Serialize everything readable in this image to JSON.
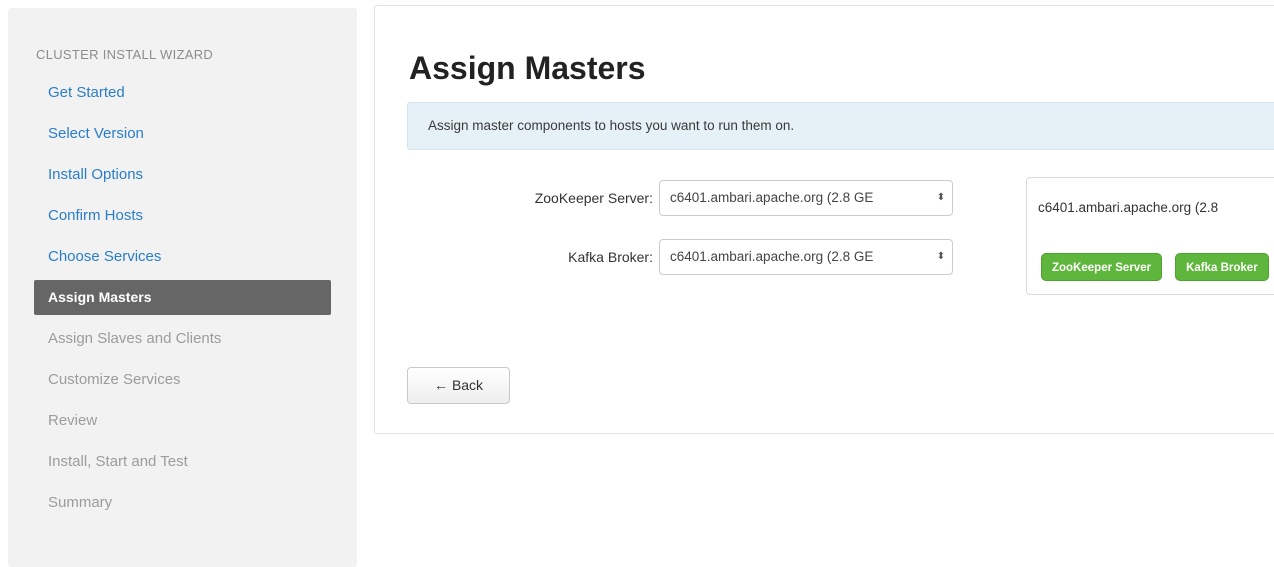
{
  "sidebar": {
    "heading": "CLUSTER INSTALL WIZARD",
    "steps": [
      {
        "label": "Get Started",
        "state": "done"
      },
      {
        "label": "Select Version",
        "state": "done"
      },
      {
        "label": "Install Options",
        "state": "done"
      },
      {
        "label": "Confirm Hosts",
        "state": "done"
      },
      {
        "label": "Choose Services",
        "state": "done"
      },
      {
        "label": "Assign Masters",
        "state": "active"
      },
      {
        "label": "Assign Slaves and Clients",
        "state": "pending"
      },
      {
        "label": "Customize Services",
        "state": "pending"
      },
      {
        "label": "Review",
        "state": "pending"
      },
      {
        "label": "Install, Start and Test",
        "state": "pending"
      },
      {
        "label": "Summary",
        "state": "pending"
      }
    ]
  },
  "main": {
    "title": "Assign Masters",
    "info": "Assign master components to hosts you want to run them on.",
    "assignments": [
      {
        "label": "ZooKeeper Server:",
        "value": "c6401.ambari.apache.org (2.8 GE"
      },
      {
        "label": "Kafka Broker:",
        "value": "c6401.ambari.apache.org (2.8 GE"
      }
    ],
    "host": {
      "name": "c6401.ambari.apache.org (2.8",
      "components": [
        "ZooKeeper Server",
        "Kafka Broker"
      ]
    },
    "back_label": "Back",
    "back_arrow": "←",
    "select_caret": "⬍"
  },
  "colors": {
    "link": "#2a7ec9",
    "active_bg": "#666666",
    "badge_green": "#5eb73c",
    "info_bg": "#e6f0f7"
  }
}
